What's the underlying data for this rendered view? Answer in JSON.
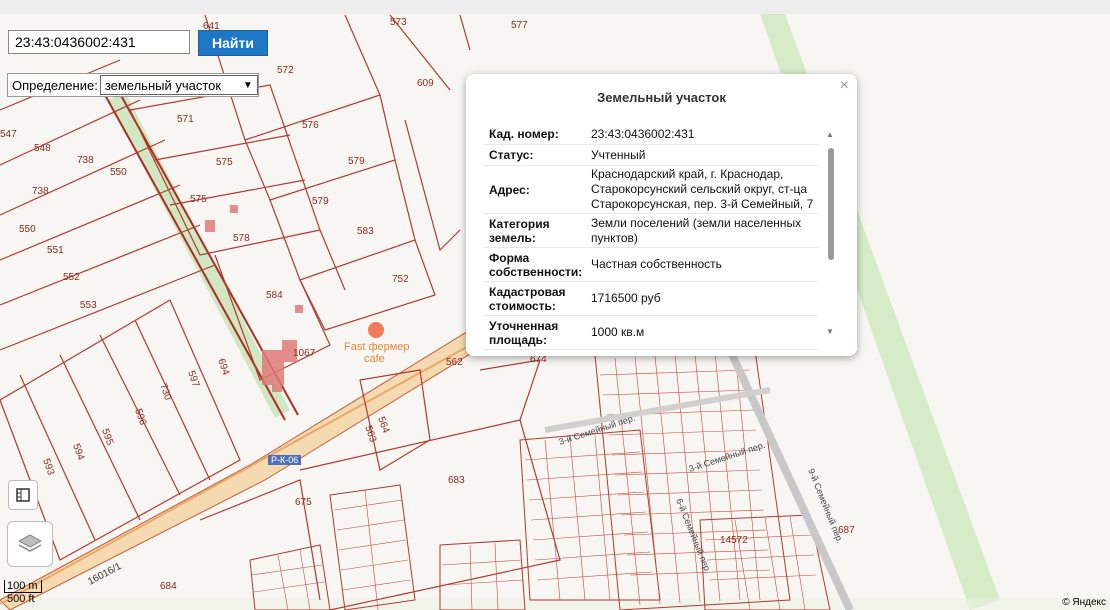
{
  "search": {
    "value": "23:43:0436002:431",
    "button_label": "Найти"
  },
  "definition": {
    "label": "Определение:",
    "selected": "земельный участок"
  },
  "popup": {
    "title": "Земельный участок",
    "close_icon": "×",
    "rows": [
      {
        "key": "Кад. номер:",
        "value": "23:43:0436002:431"
      },
      {
        "key": "Статус:",
        "value": "Учтенный"
      },
      {
        "key": "Адрес:",
        "value": "Краснодарский край, г. Краснодар, Старокорсунский сельский округ, ст-ца Старокорсунская, пер. 3-й Семейный, 7"
      },
      {
        "key": "Категория земель:",
        "value": "Земли поселений (земли населенных пунктов)"
      },
      {
        "key": "Форма собственности:",
        "value": "Частная собственность"
      },
      {
        "key": "Кадастровая стоимость:",
        "value": "1716500 руб"
      },
      {
        "key": "Уточненная площадь:",
        "value": "1000 кв.м"
      }
    ]
  },
  "map": {
    "parcel_labels": [
      "641",
      "573",
      "577",
      "572",
      "609",
      "571",
      "576",
      "575",
      "579",
      "575",
      "579",
      "578",
      "583",
      "584",
      "752",
      "1067",
      "562",
      "674",
      "683",
      "675",
      "684",
      "597",
      "694",
      "730",
      "596",
      "595",
      "594",
      "593",
      "564",
      "563",
      "548",
      "738",
      "550",
      "738",
      "550",
      "551",
      "552",
      "553",
      "547",
      "14572",
      "687"
    ],
    "street_labels": [
      "3-й Семейный пер.",
      "9-й Семейный пер.",
      "3-й Семейный пер.",
      "6-й Семейный пер."
    ],
    "poi": {
      "name": "Fast фермер",
      "sub": "cafe"
    },
    "road_badge": "Р-К-06",
    "road_code": "16016/1"
  },
  "controls": {
    "ruler_icon": "ruler-icon",
    "layers_icon": "layers-icon"
  },
  "scale": {
    "metric": "100 m",
    "imperial": "500 ft"
  },
  "attribution": "© Яндекс"
}
